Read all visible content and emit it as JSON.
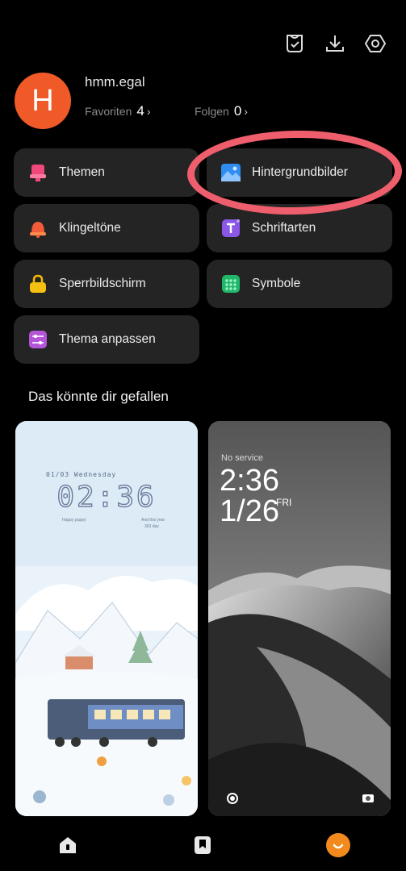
{
  "toolbar": {
    "icons": [
      "cart-check-icon",
      "download-icon",
      "settings-icon"
    ]
  },
  "profile": {
    "avatar_letter": "H",
    "username": "hmm.egal",
    "favorites_label": "Favoriten",
    "favorites_count": "4",
    "following_label": "Folgen",
    "following_count": "0"
  },
  "menu": {
    "themes": "Themen",
    "wallpapers": "Hintergrundbilder",
    "ringtones": "Klingeltöne",
    "fonts": "Schriftarten",
    "lockscreen": "Sperrbildschirm",
    "icons": "Symbole",
    "customize": "Thema anpassen"
  },
  "recommend": {
    "title": "Das könnte dir gefallen",
    "card1": {
      "date": "01/03 Wednesday",
      "time": "02:36",
      "pet_label": "Happy puppy",
      "year_label": "And this year",
      "days": "363 day"
    },
    "card2": {
      "status": "No service",
      "time": "2:36",
      "date": "1/26",
      "day": "FRI"
    }
  },
  "colors": {
    "accent": "#f05a28",
    "annotation": "#ee5e6c",
    "tile": "#242424"
  },
  "bottom_nav": [
    "home-icon",
    "bookmark-icon",
    "profile-icon"
  ]
}
